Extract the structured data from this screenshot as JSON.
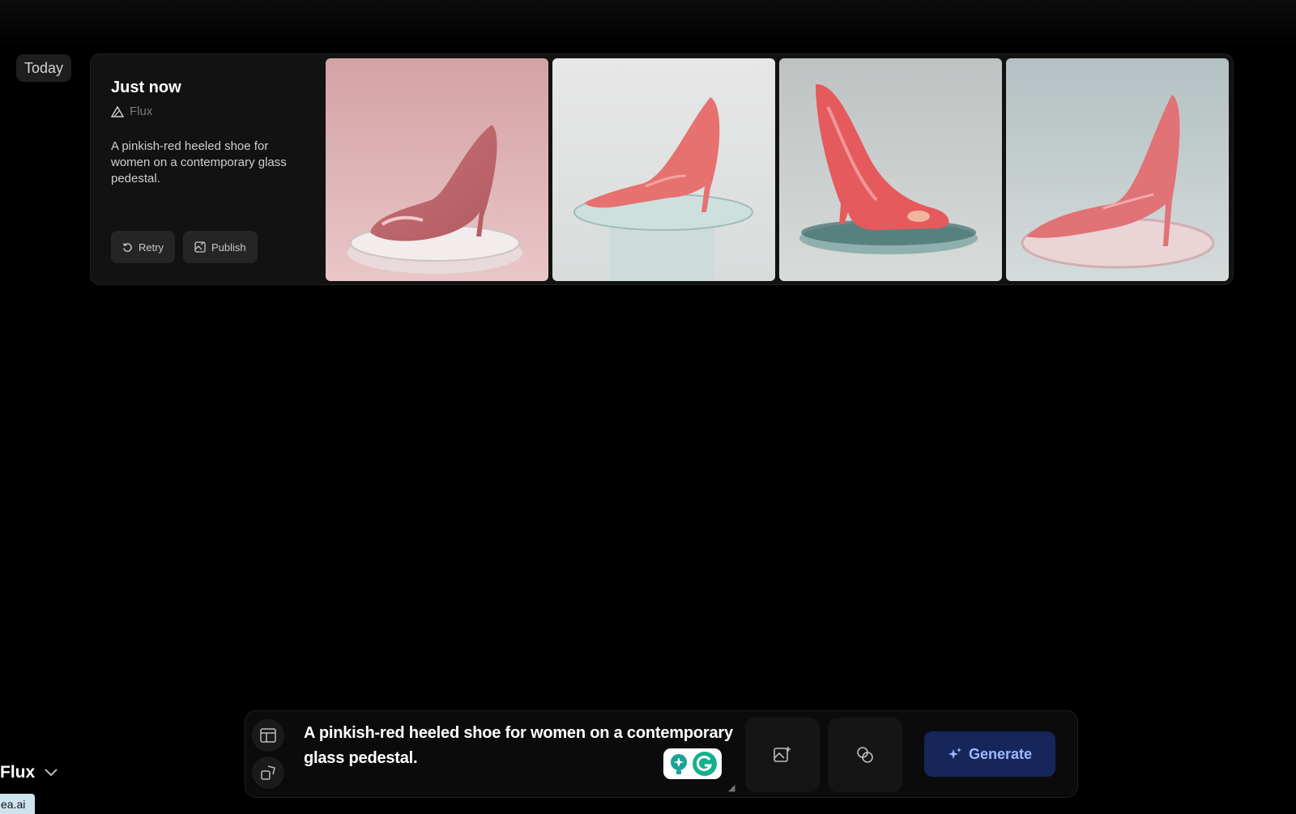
{
  "history": {
    "date_label": "Today",
    "generation": {
      "time_label": "Just now",
      "model": "Flux",
      "prompt": "A pinkish-red heeled shoe for women on a contemporary glass pedestal.",
      "retry_label": "Retry",
      "publish_label": "Publish",
      "images": [
        "pink-peep-toe-heel-on-glass-pedestal",
        "coral-pump-on-glass-column-pedestal",
        "red-peep-toe-heel-on-teal-glass-disc",
        "suede-pink-pump-on-glass-plate"
      ]
    }
  },
  "composer": {
    "prompt_text": "A pinkish-red heeled shoe for women on a contemporary glass pedestal.",
    "generate_label": "Generate"
  },
  "model_selector": {
    "label": "Flux"
  },
  "url_fragment": "ea.ai",
  "colors": {
    "accent": "#16265a",
    "accent_text": "#9dbaff",
    "card": "#121212"
  }
}
